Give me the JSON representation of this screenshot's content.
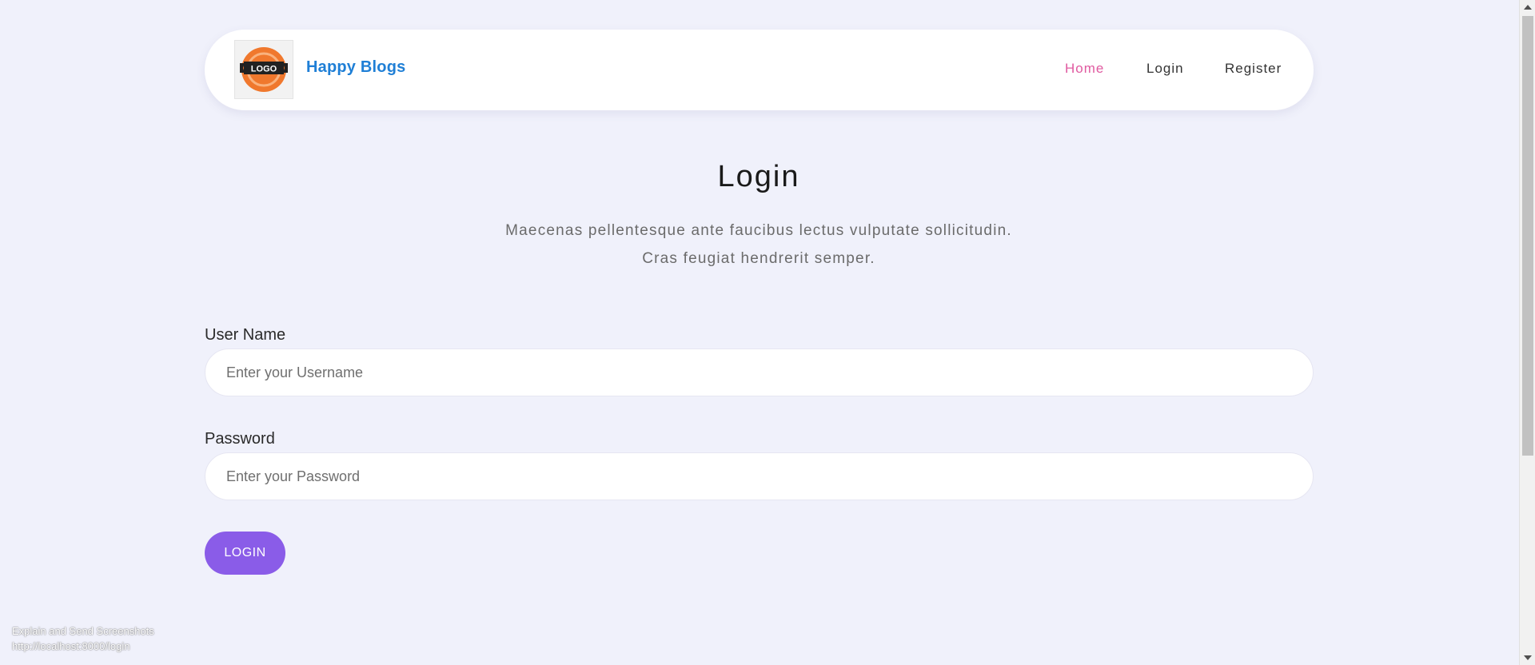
{
  "header": {
    "logo_text": "LOGO",
    "brand_name": "Happy Blogs",
    "nav": {
      "home": "Home",
      "login": "Login",
      "register": "Register"
    },
    "colors": {
      "brand": "#1f7fd6",
      "active_nav": "#e05aa0",
      "logo_orange": "#f0782d"
    }
  },
  "main": {
    "title": "Login",
    "subtitle_line1": "Maecenas pellentesque ante faucibus lectus vulputate sollicitudin.",
    "subtitle_line2": "Cras feugiat hendrerit semper."
  },
  "form": {
    "username_label": "User Name",
    "username_placeholder": "Enter your Username",
    "username_value": "",
    "password_label": "Password",
    "password_placeholder": "Enter your Password",
    "password_value": "",
    "submit_label": "LOGIN",
    "button_color": "#8a5ce8"
  },
  "overlay": {
    "line1": "Explain and Send Screenshots",
    "line2": "http://localhost:8000/login"
  }
}
